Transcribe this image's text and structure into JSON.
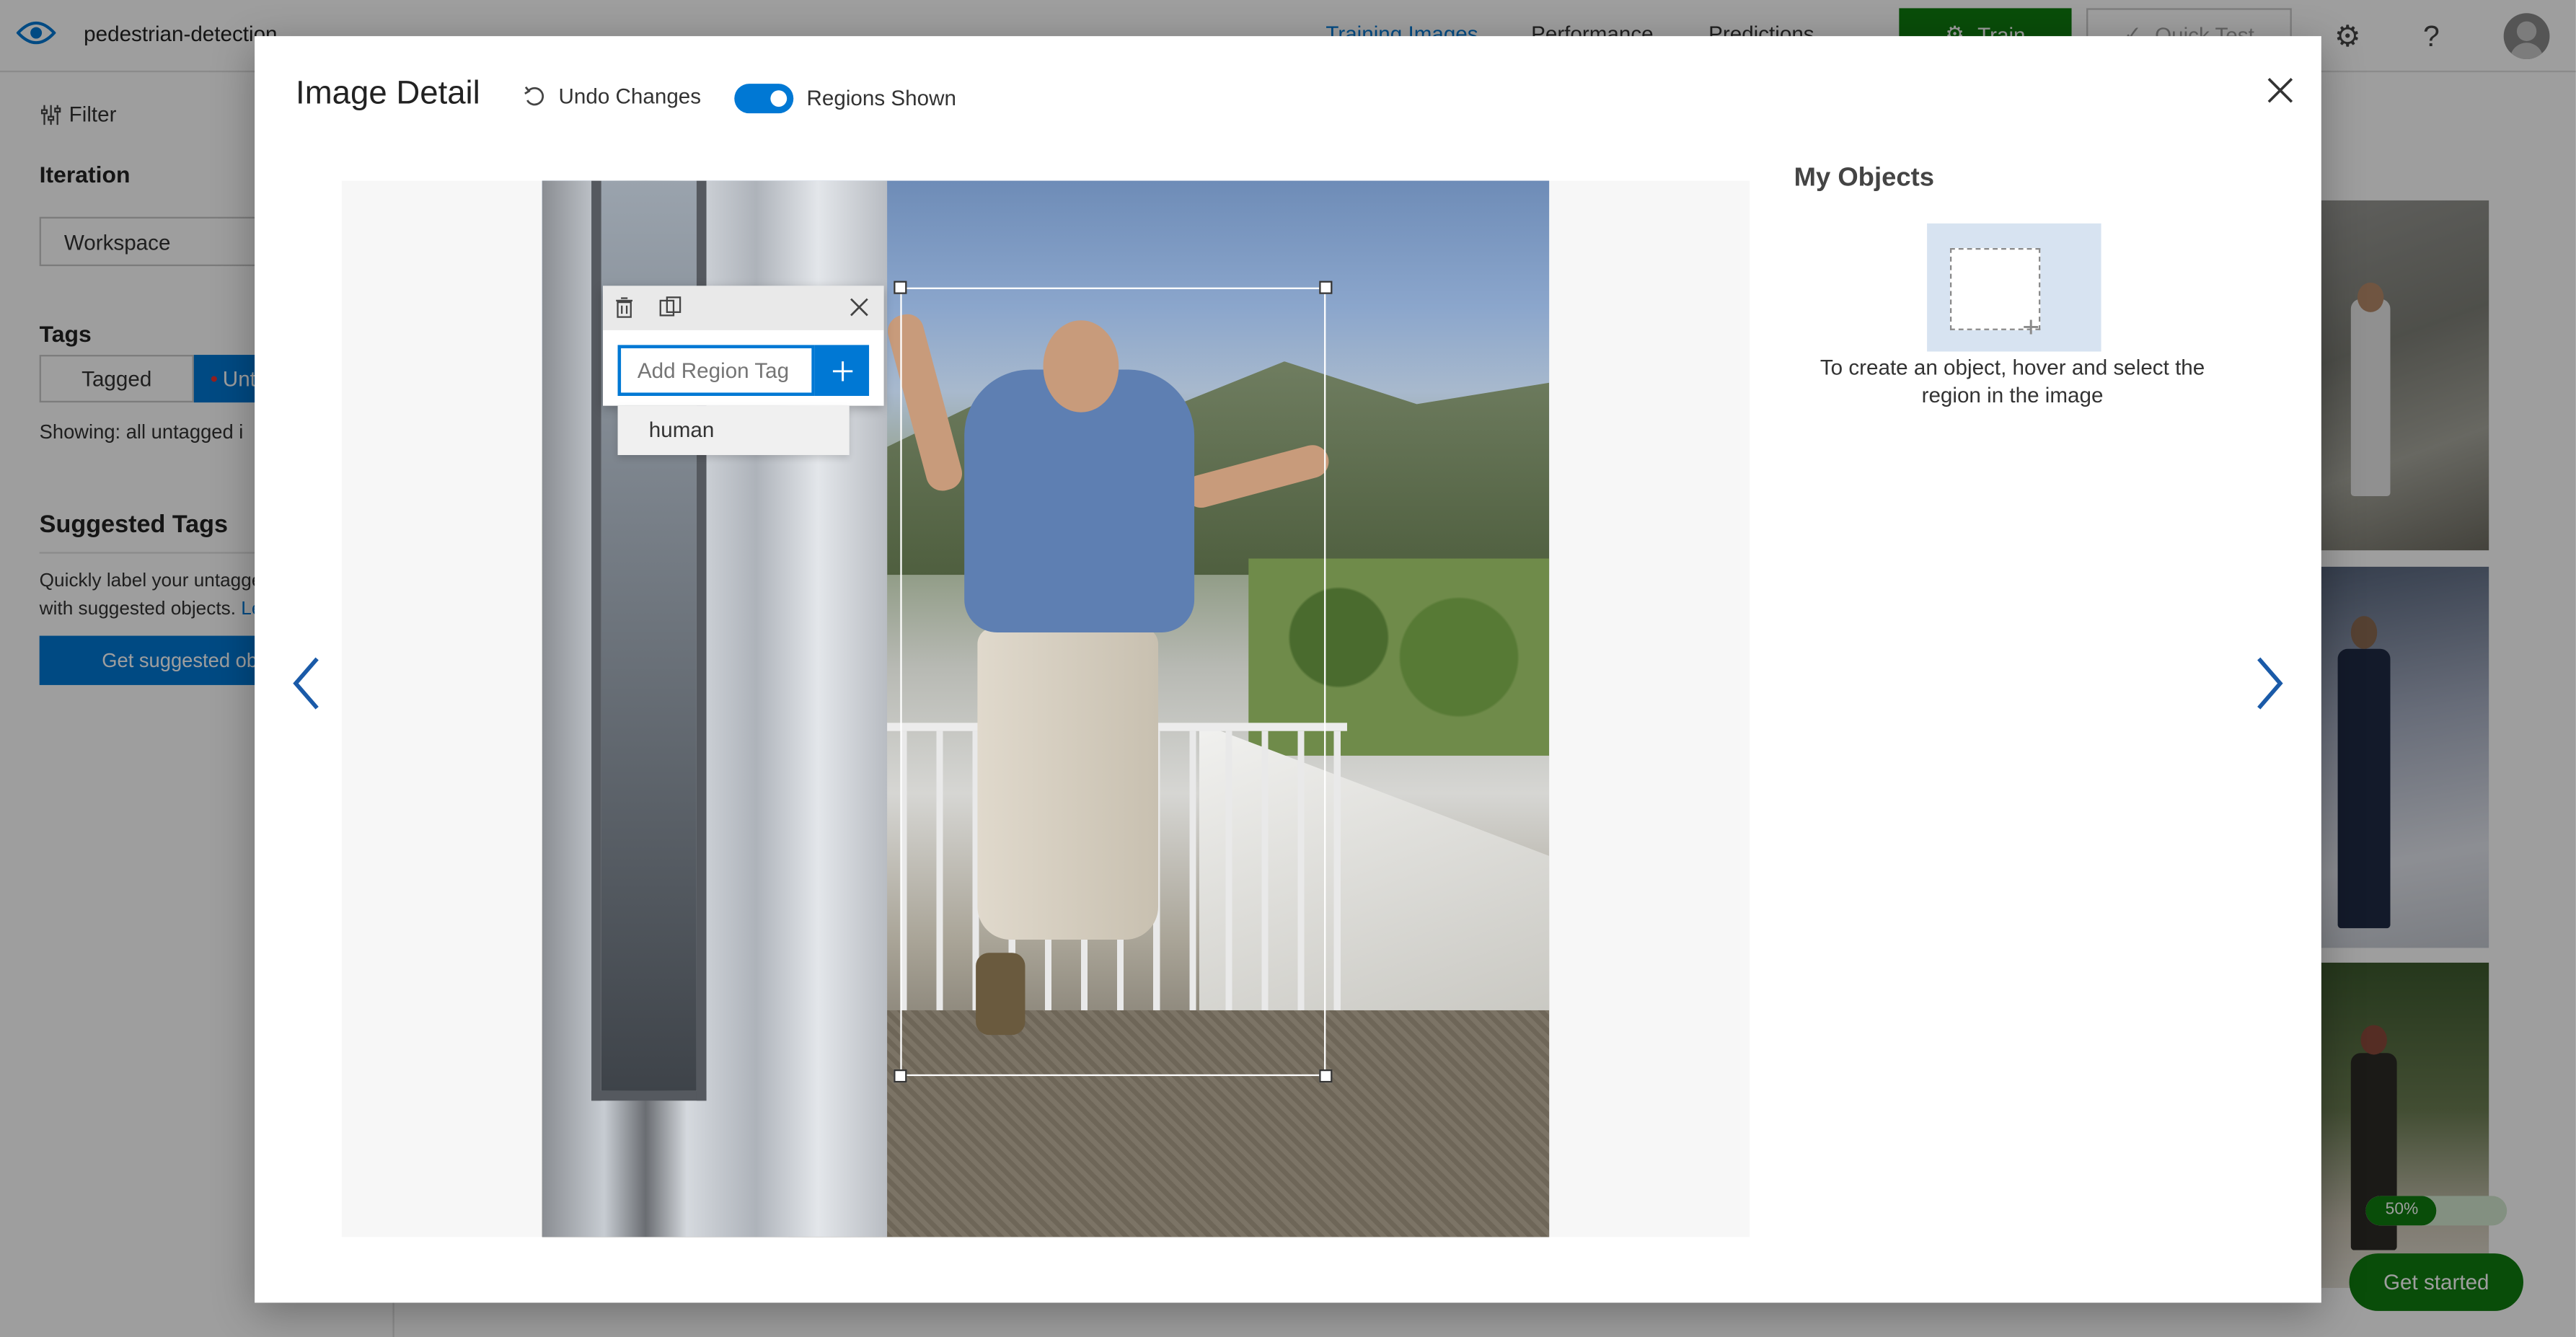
{
  "app": {
    "project_name": "pedestrian-detection",
    "nav": [
      {
        "label": "Training Images",
        "active": true
      },
      {
        "label": "Performance",
        "active": false
      },
      {
        "label": "Predictions",
        "active": false
      }
    ],
    "train_label": "Train",
    "quick_test_label": "Quick Test",
    "icons": [
      "eye-logo-icon",
      "gear-icon",
      "help-icon",
      "avatar"
    ]
  },
  "sidebar": {
    "filter_label": "Filter",
    "iteration_heading": "Iteration",
    "iteration_value": "Workspace",
    "tags_heading": "Tags",
    "tagged_label": "Tagged",
    "untagged_label": "Unt",
    "showing_text": "Showing: all untagged i",
    "suggested_heading": "Suggested Tags",
    "suggested_text_line1": "Quickly label your untagge",
    "suggested_text_line2": "with suggested objects.",
    "learn_link": "Le",
    "get_suggested_label": "Get suggested obj"
  },
  "gallery": {
    "progress_percent": 50,
    "progress_label": "50%",
    "get_started_label": "Get started"
  },
  "modal": {
    "title": "Image Detail",
    "undo_label": "Undo Changes",
    "regions_toggle_on": true,
    "regions_label": "Regions Shown",
    "region_popup": {
      "input_placeholder": "Add Region Tag",
      "suggestion": "human",
      "icons": [
        "trash-icon",
        "copy-regions-icon",
        "close-icon",
        "plus-icon"
      ]
    },
    "objects_heading": "My Objects",
    "objects_help": "To create an object, hover and select the region in the image"
  },
  "colors": {
    "accent": "#0078d4",
    "train_green": "#107c10"
  }
}
